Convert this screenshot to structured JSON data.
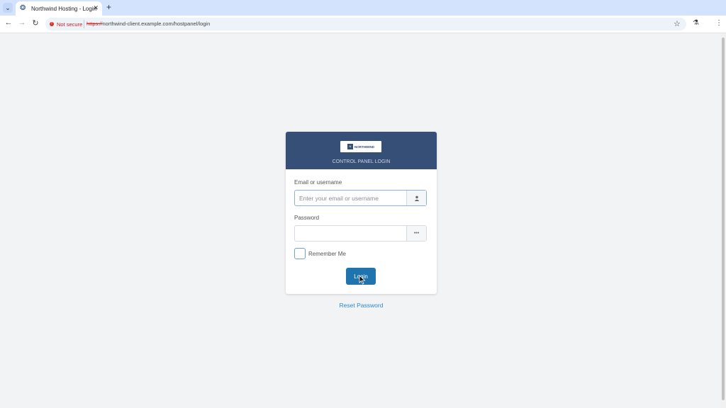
{
  "browser": {
    "tab_title": "Northwind Hosting - Login - H",
    "security_label": "Not secure",
    "url_scheme": "https://",
    "url_rest": "northwind-client.example.com/hostpanel/login",
    "icons": [
      "tab-search-icon",
      "favicon",
      "close-icon",
      "new-tab-icon",
      "back-icon",
      "forward-icon",
      "reload-icon",
      "bookmark-star-icon",
      "labs-flask-icon",
      "menu-kebab-icon"
    ]
  },
  "login": {
    "logo_text": "NORTHWIND",
    "heading": "CONTROL PANEL LOGIN",
    "email_label": "Email or username",
    "email_placeholder": "Enter your email or username",
    "email_value": "",
    "password_label": "Password",
    "password_value": "",
    "remember_label": "Remember Me",
    "remember_checked": false,
    "submit_label": "Login",
    "reset_link": "Reset Password"
  },
  "colors": {
    "header_bg": "#354f77",
    "button_bg": "#1f74ad",
    "link": "#2a87d0",
    "page_bg": "#f2f3f5"
  }
}
